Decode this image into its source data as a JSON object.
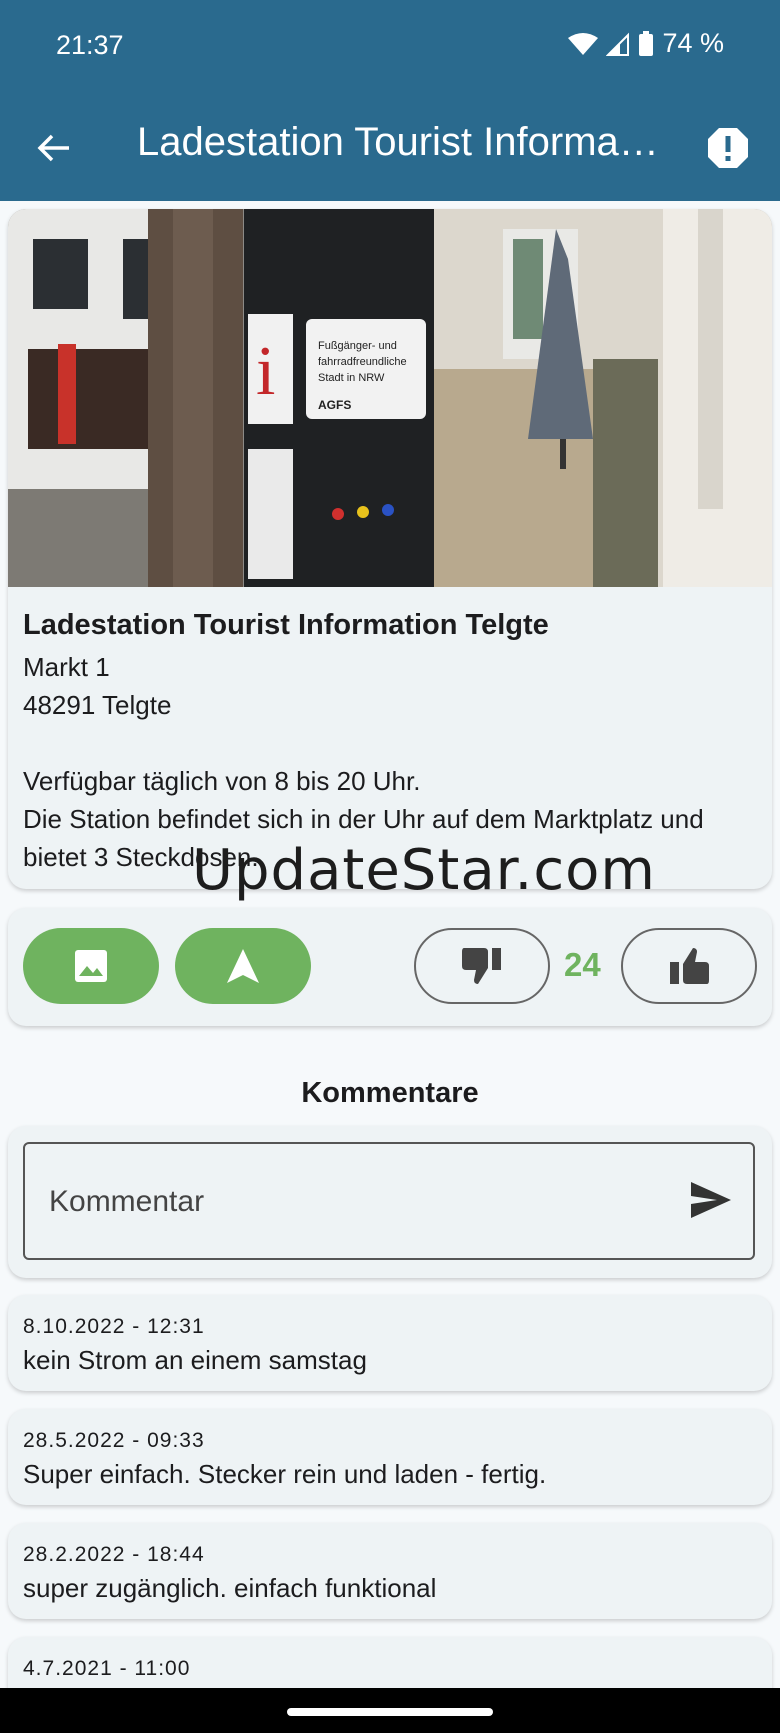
{
  "status_bar": {
    "time": "21:37",
    "battery": "74 %"
  },
  "app_bar": {
    "title": "Ladestation Tourist Information Telgte"
  },
  "station": {
    "name": "Ladestation Tourist Information Telgte",
    "street": "Markt 1",
    "city": "48291 Telgte",
    "availability": "Verfügbar täglich von 8 bis 20 Uhr.",
    "description_line1": "Die Station befindet sich in der Uhr auf dem Marktplatz und",
    "description_line2": "bietet 3 Steckdosen."
  },
  "watermark": "UpdateStar.com",
  "photo_signs": {
    "agfs_line1": "Fußgänger- und",
    "agfs_line2": "fahrradfreundliche",
    "agfs_line3": "Stadt in NRW",
    "agfs_logo": "AGFS",
    "info_letter": "i"
  },
  "votes": {
    "count": "24"
  },
  "comments_section": {
    "heading": "Kommentare",
    "input_placeholder": "Kommentar"
  },
  "comments": [
    {
      "date": "8.10.2022 - 12:31",
      "text": "kein Strom an einem samstag"
    },
    {
      "date": "28.5.2022 - 09:33",
      "text": "Super einfach. Stecker rein und laden - fertig."
    },
    {
      "date": "28.2.2022 - 18:44",
      "text": "super zugänglich. einfach funktional"
    },
    {
      "date": "4.7.2021 - 11:00",
      "text": ""
    }
  ],
  "icons": {
    "back": "arrow-left-icon",
    "report": "alert-octagon-icon",
    "gallery": "image-icon",
    "navigate": "navigation-arrow-icon",
    "dislike": "thumb-down-icon",
    "like": "thumb-up-icon",
    "send": "send-icon"
  },
  "colors": {
    "app_bar": "#2a6a8e",
    "accent_green": "#6fb35f",
    "card": "#eef3f5"
  }
}
